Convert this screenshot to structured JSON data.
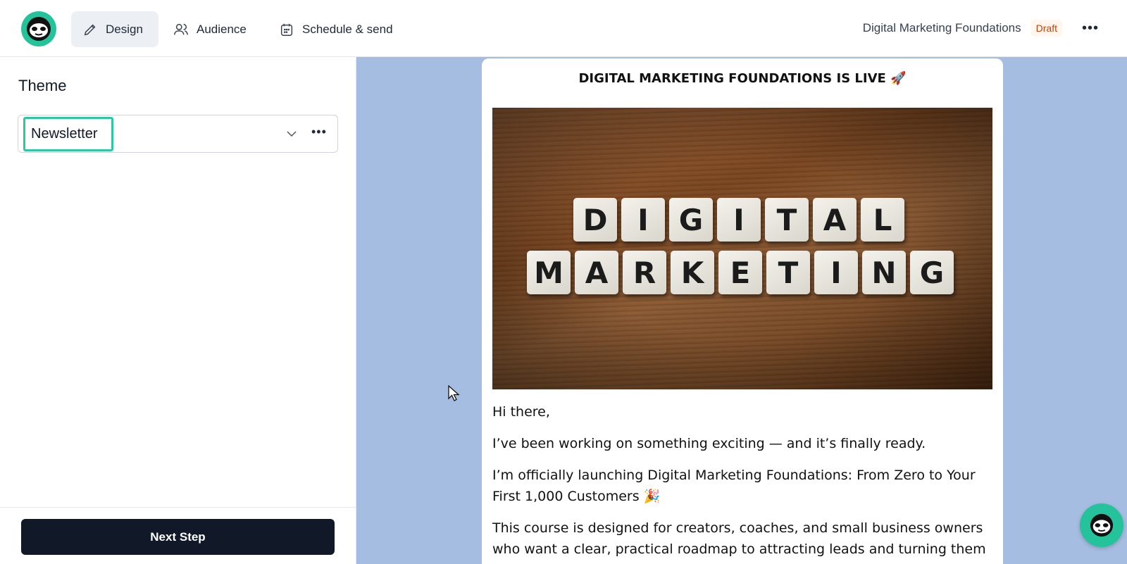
{
  "nav": {
    "tabs": [
      {
        "label": "Design",
        "icon": "pencil-icon",
        "active": true
      },
      {
        "label": "Audience",
        "icon": "users-icon",
        "active": false
      },
      {
        "label": "Schedule & send",
        "icon": "calendar-icon",
        "active": false
      }
    ],
    "campaign_title": "Digital Marketing Foundations",
    "status_badge": "Draft"
  },
  "sidebar": {
    "title": "Theme",
    "theme_select": {
      "value": "Newsletter"
    },
    "next_button": "Next Step"
  },
  "email": {
    "subject": "DIGITAL MARKETING FOUNDATIONS IS LIVE 🚀",
    "hero_words": [
      "DIGITAL",
      "MARKETING"
    ],
    "paragraphs": [
      "Hi there,",
      "I’ve been working on something exciting — and it’s finally ready.",
      "I’m officially launching Digital Marketing Foundations: From Zero to Your First 1,000 Customers 🎉",
      "This course is designed for creators, coaches, and small business owners who want a clear, practical roadmap to attracting leads and turning them into"
    ]
  },
  "colors": {
    "accent": "#25c39b",
    "preview_background": "#a5bde0",
    "primary_button": "#111827",
    "draft_badge_text": "#c2410c"
  }
}
